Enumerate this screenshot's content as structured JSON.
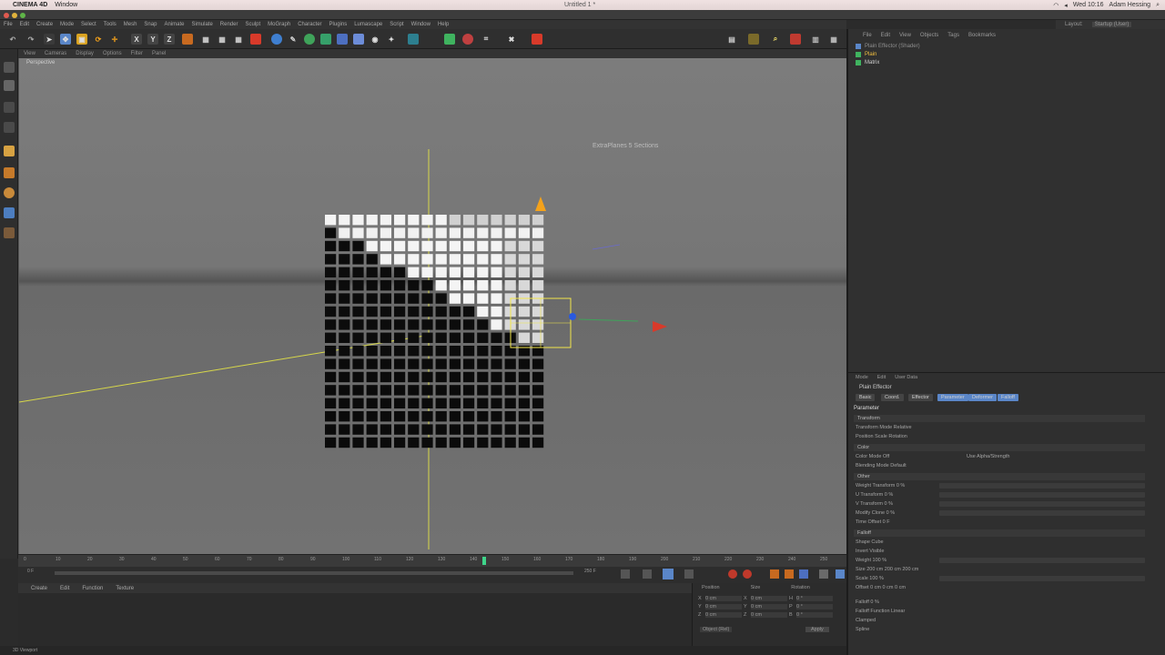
{
  "macbar": {
    "app": "CINEMA 4D",
    "menu": [
      "Window"
    ],
    "window_title": "Untitled 1 *",
    "clock": "Wed 10:16",
    "user": "Adam Hessing"
  },
  "c4d_menu": [
    "File",
    "Edit",
    "Create",
    "Mode",
    "Select",
    "Tools",
    "Mesh",
    "Snap",
    "Animate",
    "Simulate",
    "Render",
    "Sculpt",
    "MoGraph",
    "Character",
    "Plugins",
    "Lumascape",
    "Script",
    "Window",
    "Help"
  ],
  "layout": {
    "label": "Layout:",
    "value": "Startup (User)"
  },
  "toolbar": {
    "axes": [
      "X",
      "Y",
      "Z"
    ]
  },
  "viewport": {
    "menu": [
      "View",
      "Cameras",
      "Display",
      "Options",
      "Filter",
      "Panel"
    ],
    "label": "Perspective",
    "hud": "ExtraPlanes   5   Sections"
  },
  "timeline": {
    "ticks": [
      "0",
      "10",
      "20",
      "30",
      "40",
      "50",
      "60",
      "70",
      "80",
      "90",
      "100",
      "110",
      "120",
      "130",
      "140",
      "150",
      "160",
      "170",
      "180",
      "190",
      "200",
      "210",
      "220",
      "230",
      "240",
      "250"
    ],
    "current": "145",
    "end": "250 F",
    "start": "0 F"
  },
  "materials": {
    "menu": [
      "Create",
      "Edit",
      "Function",
      "Texture"
    ]
  },
  "coords": {
    "headers": [
      "Position",
      "Size",
      "Rotation"
    ],
    "rows": [
      {
        "a": "X",
        "v": "0 cm",
        "b": "X",
        "w": "0 cm",
        "c": "H",
        "r": "0 °"
      },
      {
        "a": "Y",
        "v": "0 cm",
        "b": "Y",
        "w": "0 cm",
        "c": "P",
        "r": "0 °"
      },
      {
        "a": "Z",
        "v": "0 cm",
        "b": "Z",
        "w": "0 cm",
        "c": "B",
        "r": "0 °"
      }
    ],
    "mode": "Object (Rel)",
    "apply": "Apply"
  },
  "status": "3D Viewport",
  "object_manager": {
    "menu": [
      "File",
      "Edit",
      "View",
      "Objects",
      "Tags",
      "Bookmarks"
    ],
    "objects": [
      "Plain Effector (Shader)",
      "Plain",
      "Matrix"
    ]
  },
  "attributes": {
    "menu": [
      "Mode",
      "Edit",
      "User Data"
    ],
    "object": "Plain Effector",
    "tabs": [
      "Basic",
      "Coord.",
      "Effector",
      "Parameter",
      "Deformer",
      "Falloff"
    ],
    "section": "Parameter",
    "rows": [
      "Transform",
      "Transform Mode   Relative",
      "Position   Scale   Rotation",
      "Color",
      "Color Mode   Off",
      "Use Alpha/Strength",
      "Blending Mode   Default",
      "Other",
      "Weight Transform   0 %",
      "U Transform   0 %",
      "V Transform   0 %",
      "Modify Clone   0 %",
      "Time Offset   0 F",
      "Falloff",
      "Shape   Cube",
      "Invert   Visible",
      "Weight   100 %",
      "Size   200 cm   200 cm   200 cm",
      "Scale   100 %",
      "Offset   0 cm   0 cm   0 cm",
      "Falloff   0 %",
      "Falloff Function   Linear",
      "Clamped",
      "Spline"
    ]
  },
  "colors": {
    "accent": "#5a86c8",
    "selection": "#f2e64b",
    "red": "#d83a2a",
    "orange": "#f4a21b"
  }
}
